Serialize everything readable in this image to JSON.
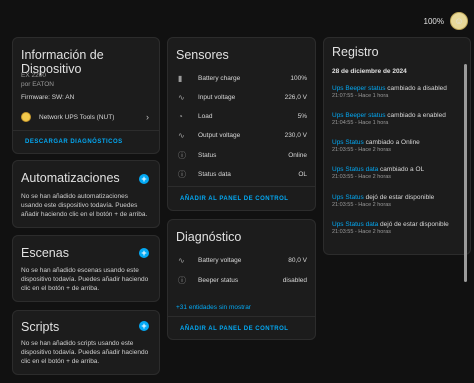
{
  "topbar": {
    "battery": "100%"
  },
  "device_info": {
    "title": "Información de Dispositivo",
    "model": "EX 2200",
    "maker": "por EATON",
    "firmware": "Firmware: SW: AN",
    "integration": "Network UPS Tools (NUT)",
    "download_button": "DESCARGAR DIAGNÓSTICOS"
  },
  "automations": {
    "title": "Automatizaciones",
    "text": "No se han añadido automatizaciones usando este dispositivo todavía. Puedes añadir haciendo clic en el botón + de arriba."
  },
  "scenes": {
    "title": "Escenas",
    "text": "No se han añadido escenas usando este dispositivo todavía. Puedes añadir haciendo clic en el botón + de arriba."
  },
  "scripts": {
    "title": "Scripts",
    "text": "No se han añadido scripts usando este dispositivo todavía. Puedes añadir haciendo clic en el botón + de arriba."
  },
  "sensors": {
    "title": "Sensores",
    "items": [
      {
        "icon": "battery-icon",
        "label": "Battery charge",
        "value": "100%"
      },
      {
        "icon": "sine-wave-icon",
        "label": "Input voltage",
        "value": "226,0 V"
      },
      {
        "icon": "gauge-icon",
        "label": "Load",
        "value": "5%"
      },
      {
        "icon": "sine-wave-icon",
        "label": "Output voltage",
        "value": "230,0 V"
      },
      {
        "icon": "info-icon",
        "label": "Status",
        "value": "Online"
      },
      {
        "icon": "info-icon",
        "label": "Status data",
        "value": "OL"
      }
    ],
    "add_button": "AÑADIR AL PANEL DE CONTROL"
  },
  "diagnostics": {
    "title": "Diagnóstico",
    "items": [
      {
        "icon": "sine-wave-icon",
        "label": "Battery voltage",
        "value": "80,0 V"
      },
      {
        "icon": "info-icon",
        "label": "Beeper status",
        "value": "disabled"
      }
    ],
    "more_link": "+31 entidades sin mostrar",
    "add_button": "AÑADIR AL PANEL DE CONTROL"
  },
  "log": {
    "title": "Registro",
    "date": "28 de diciembre de 2024",
    "entries": [
      {
        "entity": "Ups Beeper status",
        "action": " cambiado a disabled",
        "time": "21:07:55 - Hace 1 hora"
      },
      {
        "entity": "Ups Beeper status",
        "action": " cambiado a enabled",
        "time": "21:04:55 - Hace 1 hora"
      },
      {
        "entity": "Ups Status",
        "action": " cambiado a Online",
        "time": "21:03:55 - Hace 2 horas"
      },
      {
        "entity": "Ups Status data",
        "action": " cambiado a OL",
        "time": "21:03:55 - Hace 2 horas"
      },
      {
        "entity": "Ups Status",
        "action": " dejó de estar disponible",
        "time": "21:03:55 - Hace 2 horas"
      },
      {
        "entity": "Ups Status data",
        "action": " dejó de estar disponible",
        "time": "21:03:55 - Hace 2 horas"
      }
    ]
  }
}
